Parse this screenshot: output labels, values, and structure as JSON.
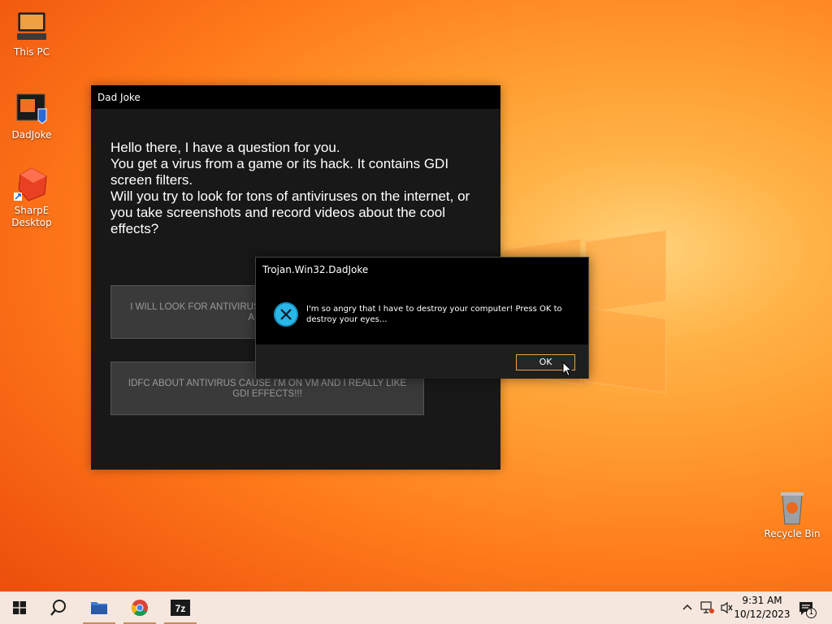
{
  "desktop": {
    "icons": [
      {
        "label": "This PC"
      },
      {
        "label": "DadJoke"
      },
      {
        "label": "SharpE Desktop"
      },
      {
        "label": "Recycle Bin"
      }
    ]
  },
  "dadjoke_window": {
    "title": "Dad Joke",
    "question": "Hello there, I have a question for you.\nYou get a virus from a game or its hack. It contains GDI screen filters.\nWill you try to look for tons of antiviruses on the internet, or you take screenshots and record videos about the cool effects?",
    "option1": "I WILL LOOK FOR ANTIVIRUSES BECAUSE IT IS DANGEROUS AND IDC",
    "option2": "IDFC ABOUT ANTIVIRUS CAUSE I'M ON VM AND I REALLY LIKE GDI EFFECTS!!!"
  },
  "message_box": {
    "title": "Trojan.Win32.DadJoke",
    "message": "I'm so angry that I have to destroy your computer! Press OK to destroy your eyes...",
    "ok_label": "OK",
    "icon": "error-icon"
  },
  "taskbar": {
    "time": "9:31 AM",
    "date": "10/12/2023",
    "notification_count": "1",
    "apps": [
      "start-icon",
      "search-icon",
      "file-explorer-icon",
      "chrome-icon",
      "7zip-icon"
    ]
  },
  "colors": {
    "accent_ok_border": "#e8a050",
    "error_icon": "#29b6e8",
    "taskbar": "#f6e7de"
  }
}
